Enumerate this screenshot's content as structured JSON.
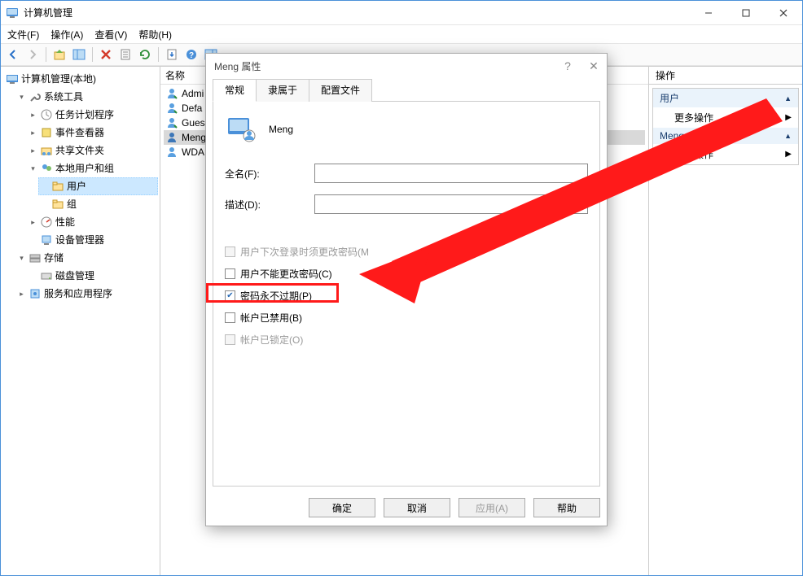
{
  "window": {
    "title": "计算机管理"
  },
  "menubar": [
    "文件(F)",
    "操作(A)",
    "查看(V)",
    "帮助(H)"
  ],
  "tree": {
    "root": "计算机管理(本地)",
    "systools": "系统工具",
    "tasks": "任务计划程序",
    "events": "事件查看器",
    "shared": "共享文件夹",
    "localusers": "本地用户和组",
    "users": "用户",
    "groups": "组",
    "perf": "性能",
    "devmgr": "设备管理器",
    "storage": "存储",
    "diskmgr": "磁盘管理",
    "services": "服务和应用程序"
  },
  "list": {
    "column": "名称",
    "items": [
      "Admi",
      "Defa",
      "Gues",
      "Meng",
      "WDA"
    ]
  },
  "actions": {
    "header": "操作",
    "s1": "用户",
    "more1": "更多操作",
    "s2": "Meng",
    "more2": "更多操作"
  },
  "dialog": {
    "title": "Meng 属性",
    "tabs": [
      "常规",
      "隶属于",
      "配置文件"
    ],
    "username": "Meng",
    "fullname_lbl": "全名(F):",
    "fullname_val": "",
    "desc_lbl": "描述(D):",
    "desc_val": "",
    "chk1": "用户下次登录时须更改密码(M",
    "chk2": "用户不能更改密码(C)",
    "chk3": "密码永不过期(P)",
    "chk4": "帐户已禁用(B)",
    "chk5": "帐户已锁定(O)",
    "btn_ok": "确定",
    "btn_cancel": "取消",
    "btn_apply": "应用(A)",
    "btn_help": "帮助"
  }
}
